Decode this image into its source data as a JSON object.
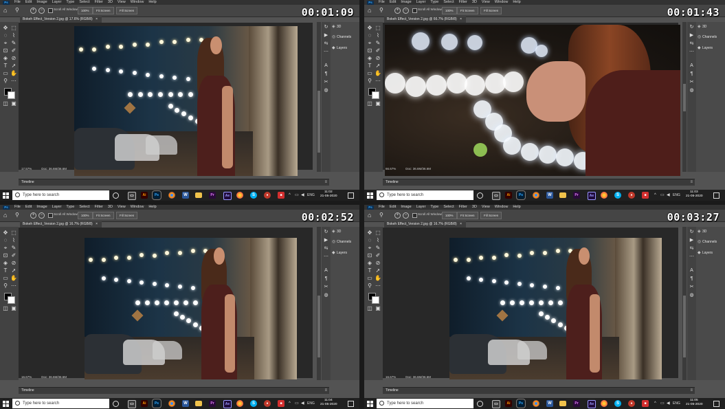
{
  "menu": {
    "ps_logo": "Ps",
    "items": [
      "File",
      "Edit",
      "Image",
      "Layer",
      "Type",
      "Select",
      "Filter",
      "3D",
      "View",
      "Window",
      "Help"
    ]
  },
  "options": {
    "scroll_all": "Scroll All Windows",
    "zoom_pct": "100%",
    "fit_screen": "Fit Screen",
    "fill_screen": "Fill Screen"
  },
  "panels": {
    "3d": "3D",
    "channels": "Channels",
    "layers": "Layers"
  },
  "taskbar": {
    "search_placeholder": "Type here to search",
    "lang": "ENG"
  },
  "timeline_label": "Timeline",
  "panes": [
    {
      "clock": "00:01:09",
      "doc_title": "Bokeh Effect_Version 2.jpg @ 17.6% (RGB/8)",
      "zoom": "17.57%",
      "doc_info": "Doc: 36.6M/36.6M",
      "time": "11:02",
      "date": "21-05-2020"
    },
    {
      "clock": "00:01:43",
      "doc_title": "Bokeh Effect_Version 2.jpg @ 66.7% (RGB/8)",
      "zoom": "66.67%",
      "doc_info": "Doc: 36.6M/36.6M",
      "time": "11:03",
      "date": "21-05-2020"
    },
    {
      "clock": "00:02:52",
      "doc_title": "Bokeh Effect_Version 2.jpg @ 16.7% (RGB/8)",
      "zoom": "16.67%",
      "doc_info": "Doc: 36.6M/36.6M",
      "time": "11:04",
      "date": "21-05-2020"
    },
    {
      "clock": "00:03:27",
      "doc_title": "Bokeh Effect_Version 2.jpg @ 16.7% (RGB/8)",
      "zoom": "16.67%",
      "doc_info": "Doc: 36.6M/36.6M",
      "time": "11:05",
      "date": "21-05-2020"
    }
  ],
  "colors": {
    "photoshop_bg": "#535353",
    "menubar": "#323232",
    "taskbar": "#202020",
    "accent": "#31a8ff"
  }
}
